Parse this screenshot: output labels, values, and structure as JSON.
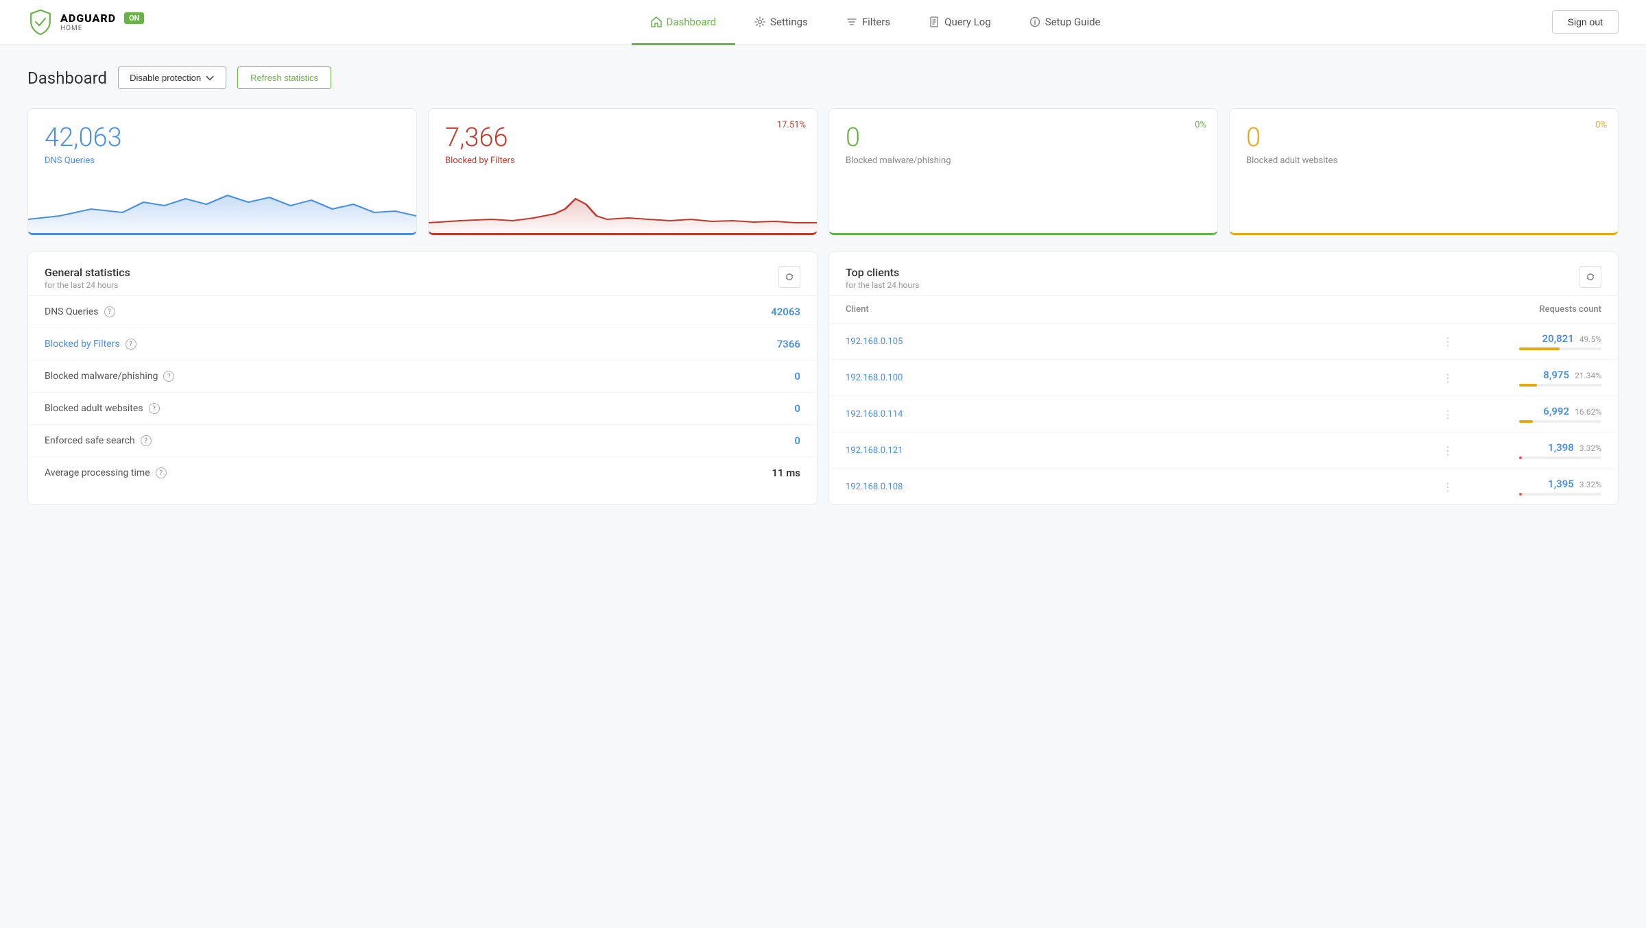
{
  "header": {
    "logo": {
      "adguard": "ADGUARD",
      "home": "HOME",
      "badge": "ON"
    },
    "nav": [
      {
        "id": "dashboard",
        "label": "Dashboard",
        "icon": "🏠",
        "active": true
      },
      {
        "id": "settings",
        "label": "Settings",
        "icon": "⚙️",
        "active": false
      },
      {
        "id": "filters",
        "label": "Filters",
        "icon": "▽",
        "active": false
      },
      {
        "id": "query-log",
        "label": "Query Log",
        "icon": "📄",
        "active": false
      },
      {
        "id": "setup-guide",
        "label": "Setup Guide",
        "icon": "ℹ️",
        "active": false
      }
    ],
    "sign_out": "Sign out"
  },
  "page": {
    "title": "Dashboard",
    "disable_btn": "Disable protection",
    "refresh_btn": "Refresh statistics"
  },
  "stat_cards": [
    {
      "id": "dns-queries",
      "value": "42,063",
      "label": "DNS Queries",
      "percent": null,
      "value_color": "blue",
      "label_color": "blue",
      "border_color": "blue"
    },
    {
      "id": "blocked-filters",
      "value": "7,366",
      "label": "Blocked by Filters",
      "percent": "17.51%",
      "value_color": "red",
      "label_color": "red",
      "border_color": "red"
    },
    {
      "id": "blocked-malware",
      "value": "0",
      "label": "Blocked malware/phishing",
      "percent": "0%",
      "value_color": "green",
      "label_color": "gray",
      "border_color": "green"
    },
    {
      "id": "blocked-adult",
      "value": "0",
      "label": "Blocked adult websites",
      "percent": "0%",
      "value_color": "yellow",
      "label_color": "gray",
      "border_color": "yellow"
    }
  ],
  "general_stats": {
    "title": "General statistics",
    "subtitle": "for the last 24 hours",
    "rows": [
      {
        "label": "DNS Queries",
        "value": "42063",
        "value_color": "blue",
        "link": false,
        "has_help": true
      },
      {
        "label": "Blocked by Filters",
        "value": "7366",
        "value_color": "blue",
        "link": true,
        "has_help": true
      },
      {
        "label": "Blocked malware/phishing",
        "value": "0",
        "value_color": "blue",
        "link": false,
        "has_help": true
      },
      {
        "label": "Blocked adult websites",
        "value": "0",
        "value_color": "blue",
        "link": false,
        "has_help": true
      },
      {
        "label": "Enforced safe search",
        "value": "0",
        "value_color": "blue",
        "link": false,
        "has_help": true
      },
      {
        "label": "Average processing time",
        "value": "11 ms",
        "value_color": "dark",
        "link": false,
        "has_help": true
      }
    ]
  },
  "top_clients": {
    "title": "Top clients",
    "subtitle": "for the last 24 hours",
    "col_client": "Client",
    "col_requests": "Requests count",
    "rows": [
      {
        "ip": "192.168.0.105",
        "count": "20,821",
        "pct": "49.5%",
        "bar_pct": 49.5,
        "bar_color": "gold"
      },
      {
        "ip": "192.168.0.100",
        "count": "8,975",
        "pct": "21.34%",
        "bar_pct": 21.34,
        "bar_color": "gold"
      },
      {
        "ip": "192.168.0.114",
        "count": "6,992",
        "pct": "16.62%",
        "bar_pct": 16.62,
        "bar_color": "gold"
      },
      {
        "ip": "192.168.0.121",
        "count": "1,398",
        "pct": "3.32%",
        "bar_pct": 3.32,
        "bar_color": "red"
      },
      {
        "ip": "192.168.0.108",
        "count": "1,395",
        "pct": "3.32%",
        "bar_pct": 3.32,
        "bar_color": "red"
      }
    ]
  }
}
